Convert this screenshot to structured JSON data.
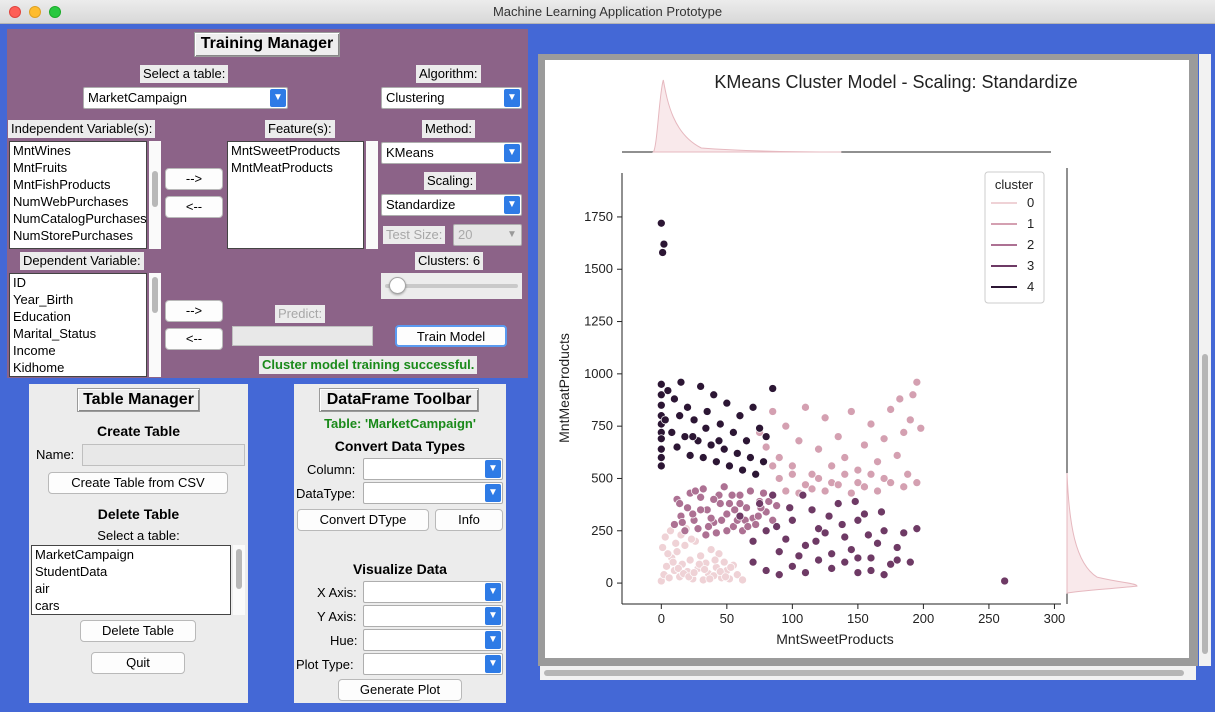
{
  "window": {
    "title": "Machine Learning Application Prototype"
  },
  "training": {
    "header": "Training Manager",
    "select_table_label": "Select a table:",
    "selected_table": "MarketCampaign",
    "algorithm_label": "Algorithm:",
    "algorithm": "Clustering",
    "indep_label": "Independent Variable(s):",
    "indep_items": [
      "MntWines",
      "MntFruits",
      "MntFishProducts",
      "NumWebPurchases",
      "NumCatalogPurchases",
      "NumStorePurchases"
    ],
    "features_label": "Feature(s):",
    "features_items": [
      "MntSweetProducts",
      "MntMeatProducts"
    ],
    "method_label": "Method:",
    "method": "KMeans",
    "scaling_label": "Scaling:",
    "scaling": "Standardize",
    "test_size_label": "Test Size:",
    "test_size": "20",
    "dep_label": "Dependent Variable:",
    "dep_items": [
      "ID",
      "Year_Birth",
      "Education",
      "Marital_Status",
      "Income",
      "Kidhome"
    ],
    "clusters_label": "Clusters: 6",
    "clusters_value": 6,
    "predict_label": "Predict:",
    "add_arrow": "-->",
    "remove_arrow": "<--",
    "train_button": "Train Model",
    "status_msg": "Cluster model training successful."
  },
  "table_manager": {
    "header": "Table Manager",
    "create_title": "Create Table",
    "name_label": "Name:",
    "create_button": "Create Table from CSV",
    "delete_title": "Delete Table",
    "select_label": "Select a table:",
    "tables": [
      "MarketCampaign",
      "StudentData",
      "air",
      "cars"
    ],
    "delete_button": "Delete Table",
    "quit_button": "Quit"
  },
  "df_toolbar": {
    "header": "DataFrame Toolbar",
    "table_line": "Table: 'MarketCampaign'",
    "convert_title": "Convert Data Types",
    "column_label": "Column:",
    "datatype_label": "DataType:",
    "convert_button": "Convert DType",
    "info_button": "Info",
    "visualize_title": "Visualize Data",
    "xaxis_label": "X Axis:",
    "yaxis_label": "Y Axis:",
    "hue_label": "Hue:",
    "plottype_label": "Plot Type:",
    "generate_button": "Generate Plot"
  },
  "colors": {
    "accent": "#2e7be6",
    "panel_purple": "#8c6388",
    "success": "#1a8a1a",
    "cluster": [
      "#efd2d6",
      "#d4a0b1",
      "#ad7193",
      "#6e3a65",
      "#2c1634"
    ]
  },
  "chart_data": {
    "type": "scatter",
    "title": "KMeans Cluster Model - Scaling: Standardize",
    "xlabel": "MntSweetProducts",
    "ylabel": "MntMeatProducts",
    "xlim": [
      -30,
      305
    ],
    "ylim": [
      -100,
      1960
    ],
    "xticks": [
      0,
      50,
      100,
      150,
      200,
      250,
      300
    ],
    "yticks": [
      0,
      250,
      500,
      750,
      1000,
      1250,
      1500,
      1750
    ],
    "legend": {
      "title": "cluster",
      "entries": [
        "0",
        "1",
        "2",
        "3",
        "4"
      ],
      "position": "top-right"
    },
    "marginals": "kde top and right",
    "series": [
      {
        "name": "0",
        "points": [
          [
            0,
            10
          ],
          [
            2,
            40
          ],
          [
            4,
            80
          ],
          [
            6,
            25
          ],
          [
            8,
            120
          ],
          [
            10,
            60
          ],
          [
            12,
            150
          ],
          [
            14,
            30
          ],
          [
            16,
            90
          ],
          [
            18,
            180
          ],
          [
            20,
            55
          ],
          [
            22,
            110
          ],
          [
            24,
            20
          ],
          [
            26,
            200
          ],
          [
            28,
            70
          ],
          [
            30,
            130
          ],
          [
            32,
            15
          ],
          [
            34,
            95
          ],
          [
            36,
            45
          ],
          [
            38,
            160
          ],
          [
            40,
            35
          ],
          [
            42,
            75
          ],
          [
            44,
            140
          ],
          [
            46,
            25
          ],
          [
            48,
            100
          ],
          [
            50,
            60
          ],
          [
            52,
            20
          ],
          [
            55,
            85
          ],
          [
            58,
            40
          ],
          [
            62,
            15
          ],
          [
            3,
            220
          ],
          [
            7,
            250
          ],
          [
            11,
            190
          ],
          [
            15,
            230
          ],
          [
            19,
            260
          ],
          [
            23,
            210
          ],
          [
            1,
            170
          ],
          [
            5,
            140
          ],
          [
            9,
            100
          ],
          [
            13,
            70
          ],
          [
            17,
            45
          ],
          [
            21,
            30
          ],
          [
            25,
            50
          ],
          [
            29,
            90
          ],
          [
            33,
            65
          ],
          [
            37,
            20
          ],
          [
            41,
            110
          ],
          [
            45,
            55
          ],
          [
            49,
            30
          ],
          [
            53,
            75
          ]
        ]
      },
      {
        "name": "1",
        "points": [
          [
            75,
            720
          ],
          [
            80,
            650
          ],
          [
            85,
            820
          ],
          [
            90,
            600
          ],
          [
            95,
            750
          ],
          [
            100,
            560
          ],
          [
            105,
            680
          ],
          [
            110,
            840
          ],
          [
            115,
            520
          ],
          [
            120,
            640
          ],
          [
            125,
            790
          ],
          [
            130,
            560
          ],
          [
            135,
            700
          ],
          [
            140,
            600
          ],
          [
            145,
            820
          ],
          [
            150,
            540
          ],
          [
            155,
            660
          ],
          [
            160,
            760
          ],
          [
            165,
            580
          ],
          [
            170,
            690
          ],
          [
            175,
            830
          ],
          [
            180,
            610
          ],
          [
            185,
            720
          ],
          [
            190,
            780
          ],
          [
            195,
            960
          ],
          [
            192,
            900
          ],
          [
            188,
            520
          ],
          [
            170,
            500
          ],
          [
            160,
            520
          ],
          [
            150,
            480
          ],
          [
            140,
            520
          ],
          [
            130,
            480
          ],
          [
            120,
            500
          ],
          [
            110,
            470
          ],
          [
            100,
            520
          ],
          [
            90,
            500
          ],
          [
            85,
            560
          ],
          [
            95,
            440
          ],
          [
            105,
            430
          ],
          [
            115,
            450
          ],
          [
            125,
            440
          ],
          [
            135,
            470
          ],
          [
            145,
            430
          ],
          [
            155,
            460
          ],
          [
            165,
            440
          ],
          [
            175,
            480
          ],
          [
            185,
            460
          ],
          [
            195,
            480
          ],
          [
            198,
            740
          ],
          [
            182,
            880
          ]
        ]
      },
      {
        "name": "2",
        "points": [
          [
            10,
            280
          ],
          [
            15,
            320
          ],
          [
            20,
            360
          ],
          [
            25,
            300
          ],
          [
            30,
            410
          ],
          [
            35,
            350
          ],
          [
            40,
            290
          ],
          [
            45,
            380
          ],
          [
            50,
            330
          ],
          [
            55,
            270
          ],
          [
            60,
            420
          ],
          [
            65,
            360
          ],
          [
            70,
            310
          ],
          [
            75,
            390
          ],
          [
            80,
            340
          ],
          [
            12,
            400
          ],
          [
            18,
            250
          ],
          [
            22,
            430
          ],
          [
            28,
            260
          ],
          [
            32,
            450
          ],
          [
            38,
            310
          ],
          [
            42,
            240
          ],
          [
            48,
            460
          ],
          [
            52,
            380
          ],
          [
            58,
            300
          ],
          [
            62,
            250
          ],
          [
            68,
            440
          ],
          [
            72,
            280
          ],
          [
            78,
            430
          ],
          [
            82,
            390
          ],
          [
            85,
            300
          ],
          [
            88,
            370
          ],
          [
            24,
            330
          ],
          [
            36,
            270
          ],
          [
            44,
            420
          ],
          [
            56,
            350
          ],
          [
            64,
            300
          ],
          [
            76,
            360
          ],
          [
            14,
            380
          ],
          [
            26,
            440
          ],
          [
            34,
            230
          ],
          [
            46,
            300
          ],
          [
            54,
            420
          ],
          [
            66,
            270
          ],
          [
            74,
            320
          ],
          [
            16,
            290
          ],
          [
            30,
            350
          ],
          [
            40,
            400
          ],
          [
            50,
            250
          ],
          [
            60,
            380
          ]
        ]
      },
      {
        "name": "3",
        "points": [
          [
            60,
            320
          ],
          [
            70,
            200
          ],
          [
            80,
            250
          ],
          [
            90,
            150
          ],
          [
            100,
            300
          ],
          [
            110,
            180
          ],
          [
            120,
            260
          ],
          [
            130,
            140
          ],
          [
            140,
            220
          ],
          [
            150,
            300
          ],
          [
            160,
            120
          ],
          [
            170,
            250
          ],
          [
            180,
            170
          ],
          [
            190,
            100
          ],
          [
            195,
            260
          ],
          [
            75,
            380
          ],
          [
            85,
            420
          ],
          [
            95,
            210
          ],
          [
            105,
            130
          ],
          [
            115,
            350
          ],
          [
            125,
            240
          ],
          [
            135,
            380
          ],
          [
            145,
            160
          ],
          [
            155,
            330
          ],
          [
            165,
            190
          ],
          [
            175,
            90
          ],
          [
            185,
            240
          ],
          [
            70,
            100
          ],
          [
            80,
            60
          ],
          [
            90,
            40
          ],
          [
            100,
            80
          ],
          [
            110,
            50
          ],
          [
            120,
            110
          ],
          [
            130,
            70
          ],
          [
            140,
            100
          ],
          [
            150,
            120
          ],
          [
            160,
            60
          ],
          [
            170,
            40
          ],
          [
            180,
            110
          ],
          [
            150,
            50
          ],
          [
            88,
            270
          ],
          [
            98,
            360
          ],
          [
            108,
            420
          ],
          [
            118,
            200
          ],
          [
            128,
            320
          ],
          [
            138,
            280
          ],
          [
            148,
            390
          ],
          [
            158,
            230
          ],
          [
            168,
            340
          ],
          [
            262,
            10
          ]
        ]
      },
      {
        "name": "4",
        "points": [
          [
            0,
            1720
          ],
          [
            2,
            1620
          ],
          [
            1,
            1580
          ],
          [
            0,
            950
          ],
          [
            0,
            900
          ],
          [
            0,
            850
          ],
          [
            0,
            800
          ],
          [
            0,
            760
          ],
          [
            0,
            720
          ],
          [
            0,
            690
          ],
          [
            0,
            640
          ],
          [
            0,
            600
          ],
          [
            0,
            560
          ],
          [
            5,
            920
          ],
          [
            10,
            880
          ],
          [
            15,
            960
          ],
          [
            20,
            840
          ],
          [
            25,
            780
          ],
          [
            30,
            940
          ],
          [
            35,
            820
          ],
          [
            40,
            900
          ],
          [
            45,
            760
          ],
          [
            50,
            860
          ],
          [
            55,
            720
          ],
          [
            60,
            800
          ],
          [
            65,
            680
          ],
          [
            70,
            840
          ],
          [
            75,
            740
          ],
          [
            80,
            700
          ],
          [
            85,
            930
          ],
          [
            8,
            720
          ],
          [
            12,
            650
          ],
          [
            18,
            700
          ],
          [
            22,
            610
          ],
          [
            28,
            680
          ],
          [
            32,
            600
          ],
          [
            38,
            660
          ],
          [
            42,
            580
          ],
          [
            48,
            640
          ],
          [
            52,
            560
          ],
          [
            58,
            620
          ],
          [
            62,
            540
          ],
          [
            68,
            600
          ],
          [
            72,
            520
          ],
          [
            78,
            580
          ],
          [
            3,
            780
          ],
          [
            14,
            800
          ],
          [
            24,
            700
          ],
          [
            34,
            740
          ],
          [
            44,
            680
          ]
        ]
      }
    ]
  }
}
